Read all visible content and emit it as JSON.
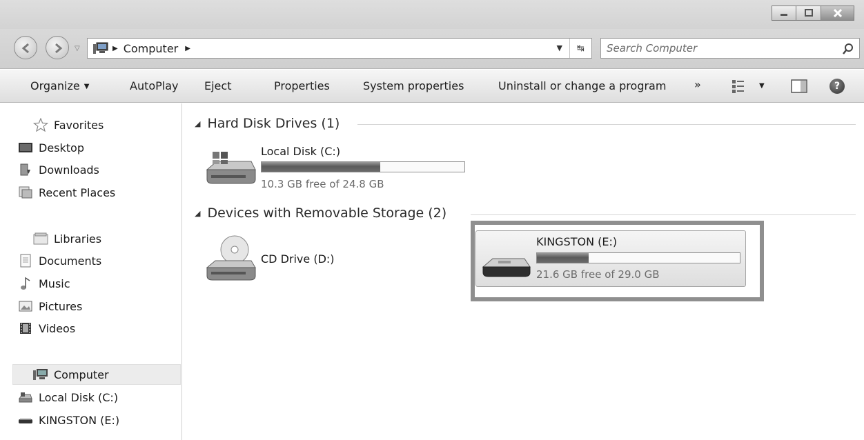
{
  "window": {
    "minimize_icon": "minimize-icon",
    "maximize_icon": "maximize-icon",
    "close_icon": "close-icon"
  },
  "address": {
    "location": "Computer",
    "search_placeholder": "Search Computer"
  },
  "toolbar": {
    "organize": "Organize",
    "autoplay": "AutoPlay",
    "eject": "Eject",
    "properties": "Properties",
    "system_properties": "System properties",
    "uninstall": "Uninstall or change a program",
    "more": "»"
  },
  "sidebar": {
    "favorites": "Favorites",
    "desktop": "Desktop",
    "downloads": "Downloads",
    "recent_places": "Recent Places",
    "libraries": "Libraries",
    "documents": "Documents",
    "music": "Music",
    "pictures": "Pictures",
    "videos": "Videos",
    "computer": "Computer",
    "local_disk": "Local Disk (C:)",
    "kingston": "KINGSTON (E:)"
  },
  "groups": {
    "hard_disks": "Hard Disk Drives (1)",
    "removable": "Devices with Removable Storage (2)"
  },
  "drives": {
    "c": {
      "name": "Local Disk (C:)",
      "free_text": "10.3 GB free of 24.8 GB",
      "used_fraction": 0.585
    },
    "d": {
      "name": "CD Drive (D:)"
    },
    "e": {
      "name": "KINGSTON (E:)",
      "free_text": "21.6 GB free of 29.0 GB",
      "used_fraction": 0.255
    }
  },
  "colors": {
    "selection": "#e6e6e6",
    "highlight_border": "#8f8f8f"
  }
}
